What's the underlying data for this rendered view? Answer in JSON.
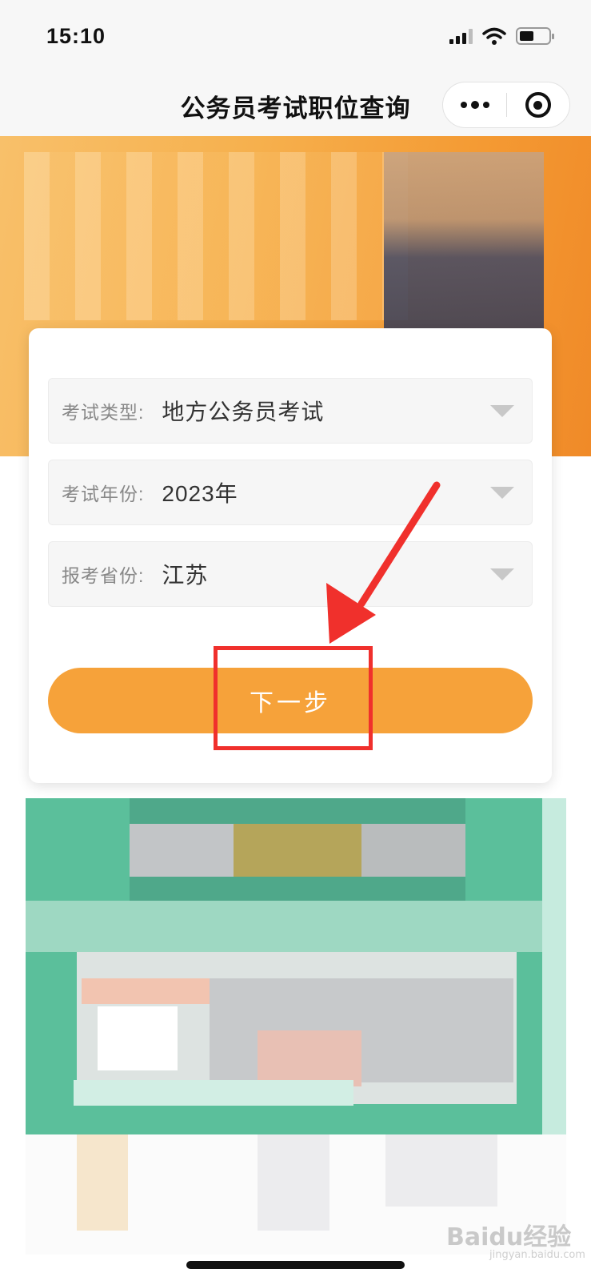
{
  "status_bar": {
    "time": "15:10",
    "icons": [
      "signal-icon",
      "wifi-icon",
      "battery-icon"
    ]
  },
  "nav_bar": {
    "title": "公务员考试职位查询",
    "more_icon": "more-dots-icon",
    "close_icon": "target-close-icon"
  },
  "form": {
    "fields": [
      {
        "label": "考试类型:",
        "value": "地方公务员考试"
      },
      {
        "label": "考试年份:",
        "value": "2023年"
      },
      {
        "label": "报考省份:",
        "value": "江苏"
      }
    ],
    "next_label": "下一步"
  },
  "watermark": {
    "text": "Baidu经验",
    "sub": "jingyan.baidu.com"
  },
  "colors": {
    "accent": "#f6a23a",
    "annotation": "#f0302c",
    "banner": "#f6b04d",
    "mosaic": "#5bbf9b"
  }
}
